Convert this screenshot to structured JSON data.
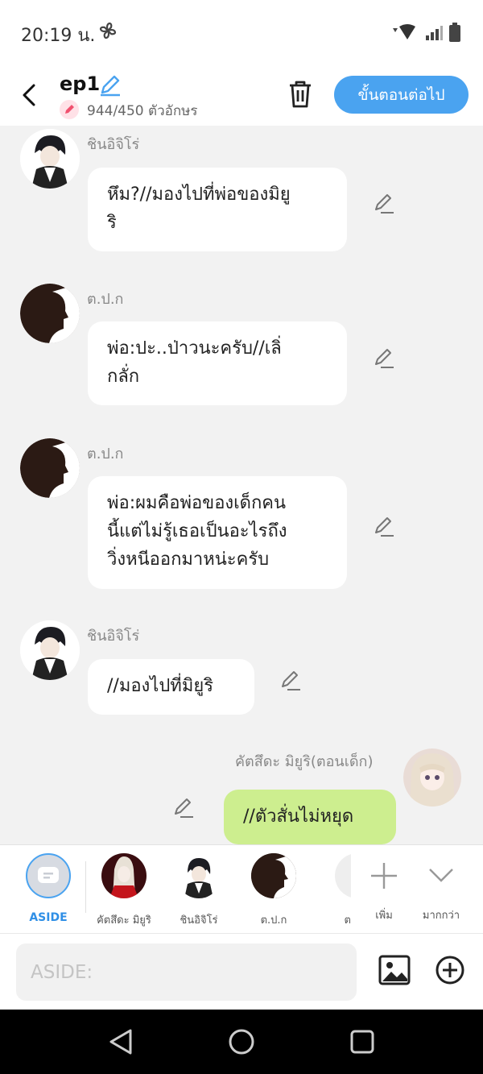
{
  "status_bar": {
    "time": "20:19 น."
  },
  "header": {
    "title": "ep1",
    "char_count": "944/450 ตัวอักษร",
    "next_label": "ขั้นตอนต่อไป"
  },
  "messages": [
    {
      "sender": "ชินอิจิโร่",
      "lines": [
        "หึม?//มองไปที่พ่อของมิยู",
        "ริ"
      ]
    },
    {
      "sender": "ต.ป.ก",
      "lines": [
        "พ่อ:ปะ..ป่าวนะครับ//เลิ่",
        "กลั่ก"
      ]
    },
    {
      "sender": "ต.ป.ก",
      "lines": [
        "พ่อ:ผมคือพ่อของเด็กคน",
        "นี้แต่ไม่รู้เธอเป็นอะไรถึง",
        "วิ่งหนีออกมาหน่ะครับ"
      ]
    },
    {
      "sender": "ชินอิจิโร่",
      "lines": [
        "//มองไปที่มิยูริ"
      ]
    },
    {
      "sender": "คัตสึดะ มิยูริ(ตอนเด็ก)",
      "lines": [
        "//ตัวสั่นไม่หยุด"
      ]
    }
  ],
  "characters": {
    "aside_label": "ASIDE",
    "items": [
      {
        "label": "คัตสึดะ มิยูริ"
      },
      {
        "label": "ชินอิจิโร่"
      },
      {
        "label": "ต.ป.ก"
      },
      {
        "label": "ต"
      }
    ],
    "add_label": "เพิ่ม",
    "more_label": "มากกว่า"
  },
  "composer": {
    "placeholder": "ASIDE:"
  },
  "colors": {
    "accent": "#4aa3f0",
    "my_bubble": "#cdee8f",
    "chat_bg": "#f2f2f2"
  },
  "icons": [
    "back-icon",
    "pencil-icon",
    "trash-icon",
    "image-icon",
    "plus-circle-icon",
    "plus-icon",
    "chevron-down-icon",
    "wifi-icon",
    "signal-icon",
    "battery-icon"
  ]
}
